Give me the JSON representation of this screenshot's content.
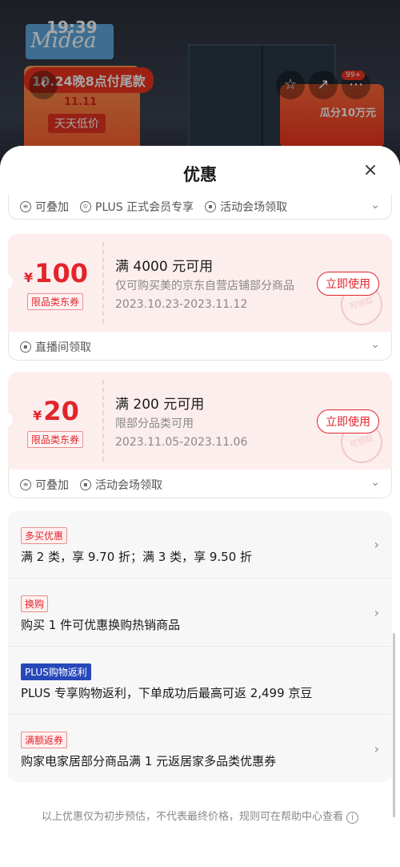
{
  "background": {
    "time": "19:39",
    "brand": "Midea",
    "promo_banner": "10.24晚8点付尾款",
    "promo_1111": "11.11",
    "promo_daily": "天天低价",
    "promo_right": "瓜分10万元",
    "badge": "99+"
  },
  "sheet": {
    "title": "优惠",
    "close": "×"
  },
  "top_partial_footer": {
    "items": [
      "可叠加",
      "PLUS 正式会员专享",
      "活动会场领取"
    ]
  },
  "coupons": [
    {
      "currency": "¥",
      "amount": "100",
      "tag": "限品类东券",
      "condition": "满 4000 元可用",
      "scope": "仅可购买美的京东自营店铺部分商品",
      "dates": "2023.10.23-2023.11.12",
      "button": "立即使用",
      "stamp": "可领取",
      "footer": [
        "直播间领取"
      ]
    },
    {
      "currency": "¥",
      "amount": "20",
      "tag": "限品类东券",
      "condition": "满 200 元可用",
      "scope": "限部分品类可用",
      "dates": "2023.11.05-2023.11.06",
      "button": "立即使用",
      "stamp": "可领取",
      "footer": [
        "可叠加",
        "活动会场领取"
      ]
    }
  ],
  "promotions": [
    {
      "tag": "多买优惠",
      "text": "满 2 类，享 9.70 折；满 3 类，享 9.50 折",
      "style": "red"
    },
    {
      "tag": "换购",
      "text": "购买 1 件可优惠换购热销商品",
      "style": "red"
    },
    {
      "tag": "PLUS购物返利",
      "text": "PLUS 专享购物返利，下单成功后最高可返 2,499 京豆",
      "style": "plus"
    },
    {
      "tag": "满额返券",
      "text": "购家电家居部分商品满 1 元返居家多品类优惠券",
      "style": "red"
    }
  ],
  "disclaimer": "以上优惠仅为初步预估，不代表最终价格，规则可在帮助中心查看",
  "icons": {
    "back": "chevron-left-icon",
    "favorite": "star-icon",
    "share": "share-icon",
    "more": "more-icon",
    "info": "info-icon"
  },
  "colors": {
    "accent_red": "#e3242b",
    "plus_blue": "#2748b9",
    "coupon_bg": "#fdeeee"
  }
}
